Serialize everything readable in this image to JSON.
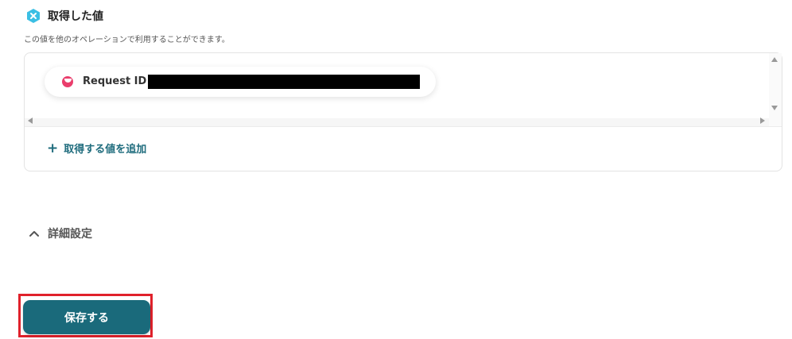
{
  "section": {
    "icon": "x-badge-icon",
    "title": "取得した値",
    "description": "この値を他のオペレーションで利用することができます。"
  },
  "values": {
    "items": [
      {
        "icon": "service-logo-icon",
        "label": "Request ID",
        "value_redacted": true
      }
    ],
    "add_button_label": "取得する値を追加",
    "add_icon": "plus-icon"
  },
  "advanced": {
    "label": "詳細設定",
    "icon": "chevron-up-icon"
  },
  "save_button": {
    "label": "保存する",
    "highlighted": true
  },
  "colors": {
    "accent": "#1a6a7b",
    "highlight": "#e0212b",
    "badge": "#3bbfe4",
    "chip_icon": "#ea3e6c"
  }
}
